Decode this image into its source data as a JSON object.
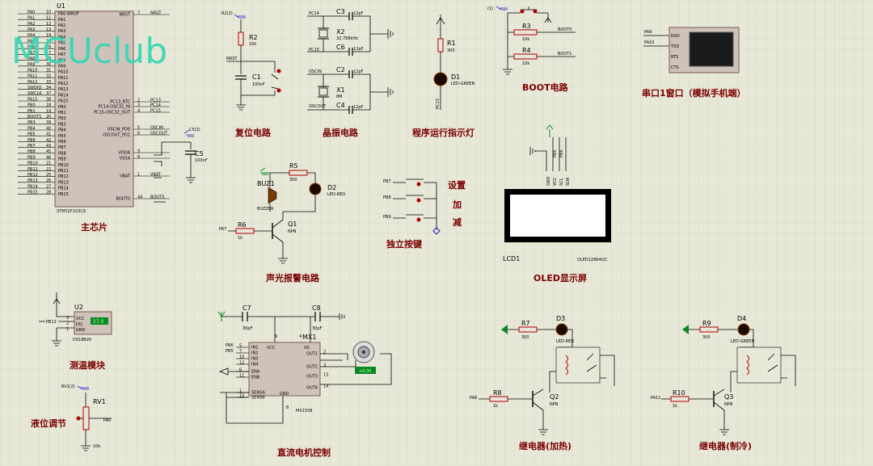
{
  "watermark": "MCUclub",
  "sections": {
    "main_chip": "主芯片",
    "reset": "复位电路",
    "crystal": "晶振电路",
    "indicator": "程序运行指示灯",
    "boot": "BOOT电路",
    "uart": "串口1窗口（模拟手机端）",
    "alarm": "声光报警电路",
    "keys": "独立按键",
    "oled": "OLED显示屏",
    "temp": "测温模块",
    "motor": "直流电机控制",
    "relay_heat": "继电器(加热)",
    "relay_cool": "继电器(制冷)",
    "level": "液位调节"
  },
  "keys_labels": [
    "设置",
    "加",
    "减"
  ],
  "mcu": {
    "ref": "U1",
    "part": "STM32F103C8",
    "left_pins": [
      "PA0",
      "PA1",
      "PA2",
      "PA3",
      "PA4",
      "PA5",
      "PA6",
      "PA7",
      "PA8",
      "PA9",
      "PA10",
      "PA11",
      "PA12",
      "SWDIO",
      "SWCLK",
      "PA15",
      "PB0",
      "PB1",
      "BOOT1",
      "PB3",
      "PB4",
      "PB5",
      "PB6",
      "PB7",
      "PB8",
      "PB9",
      "PB10",
      "PB11",
      "PB12",
      "PB13",
      "PB14",
      "PB15"
    ],
    "left_nums": [
      "10",
      "11",
      "12",
      "13",
      "14",
      "15",
      "16",
      "17",
      "29",
      "30",
      "31",
      "32",
      "33",
      "34",
      "37",
      "38",
      "18",
      "19",
      "20",
      "39",
      "40",
      "41",
      "42",
      "43",
      "45",
      "46",
      "21",
      "22",
      "25",
      "26",
      "27",
      "28"
    ],
    "left_inner": [
      "PA0-WKUP",
      "PA1",
      "PA2",
      "PA3",
      "PA4",
      "PA5",
      "PA6",
      "PA7",
      "PA8",
      "PA9",
      "PA10",
      "PA11",
      "PA12",
      "PA13",
      "PA14",
      "PA15",
      "PB0",
      "PB1",
      "PB2",
      "PB3",
      "PB4",
      "PB5",
      "PB6",
      "PB7",
      "PB8",
      "PB9",
      "PB10",
      "PB11",
      "PB12",
      "PB13",
      "PB14",
      "PB15"
    ],
    "right_pins": [
      "NRST",
      "PC13_RTC",
      "PC14-OSC32_IN",
      "PC15-OSC32_OUT",
      "OSCIN_PD0",
      "OSCOUT_PD1",
      "VDDA",
      "VSSA",
      "VBAT",
      "BOOT0"
    ],
    "right_nums": [
      "7",
      "2",
      "3",
      "4",
      "5",
      "6",
      "9",
      "8",
      "1",
      "44"
    ],
    "right_nets": [
      "NRST",
      "PC13",
      "PC14",
      "PC15",
      "OSCIN",
      "OSCOUT",
      "",
      "",
      "VBAT",
      "BOOT0"
    ]
  },
  "reset_circuit": {
    "r": "R2",
    "r_val": "10k",
    "c": "C1",
    "c_val": "100nF",
    "net": "NRST",
    "probe": "R2(2)"
  },
  "crystal_circuit": {
    "x2": "X2",
    "x2_freq": "32.768kHz",
    "x1": "X1",
    "x1_freq": "8M",
    "c3": "C3",
    "c6": "C6",
    "c2": "C2",
    "c4": "C4",
    "c_val": "12pF",
    "nets": [
      "PC14",
      "PC15",
      "OSCIN",
      "OSCOUT"
    ]
  },
  "indicator_circuit": {
    "r": "R1",
    "r_val": "300",
    "d": "D1",
    "d_type": "LED-GREEN",
    "net": "PC13"
  },
  "boot_circuit": {
    "r3": "R3",
    "r4": "R4",
    "r_val": "10k",
    "nets": [
      "BOOT0",
      "BOOT1"
    ],
    "probe": "(1)"
  },
  "uart_circuit": {
    "nets": [
      "PA9",
      "PA10"
    ],
    "pins": [
      "RXD",
      "TXD",
      "RTS",
      "CTS"
    ]
  },
  "vdda_cap": {
    "c": "C5",
    "c_val": "100nF",
    "probe": "C5(2)"
  },
  "alarm_circuit": {
    "r5": "R5",
    "r5_val": "300",
    "d2": "D2",
    "d2_type": "LED-RED",
    "buz": "BUZ1",
    "buz_type": "BUZZER",
    "r6": "R6",
    "r6_val": "1k",
    "q": "Q1",
    "q_type": "NPN",
    "net": "PA7"
  },
  "keys_circuit": {
    "nets": [
      "PB7",
      "PB8",
      "PB9"
    ]
  },
  "oled_module": {
    "ref": "LCD1",
    "part": "OLED12864I2C",
    "pins": [
      "GND",
      "VCC",
      "SCL",
      "SDA"
    ],
    "nets": [
      "PB5",
      "PB6"
    ]
  },
  "temp_module": {
    "ref": "U2",
    "part": "DS18B20",
    "pins": [
      "VCC",
      "DQ",
      "GND"
    ],
    "nums": [
      "3",
      "2",
      "1"
    ],
    "net": "PB12",
    "reading": "27.0"
  },
  "motor_circuit": {
    "c7": "C7",
    "c8": "C8",
    "c_val": "30pF",
    "mx": "MX1",
    "mx_part": "MX1508",
    "left_pins": [
      "IN1",
      "IN2",
      "IN3",
      "IN4",
      "ENA",
      "ENB",
      "SENSA",
      "SENSB"
    ],
    "left_nums": [
      "5",
      "7",
      "10",
      "12",
      "6",
      "11",
      "1",
      "15"
    ],
    "right_pins": [
      "OUT1",
      "OUT2",
      "OUT3",
      "OUT4"
    ],
    "right_nums": [
      "2",
      "3",
      "13",
      "14"
    ],
    "top_pins": [
      "VCC",
      "VS"
    ],
    "top_nums": [
      "9",
      "4"
    ],
    "gnd_pin": "GND",
    "gnd_num": "8",
    "nets": [
      "PB6",
      "PB5"
    ]
  },
  "relay_heat_circuit": {
    "r7": "R7",
    "r7_val": "300",
    "d3": "D3",
    "d3_type": "LED-RED",
    "r8": "R8",
    "r8_val": "1k",
    "q": "Q2",
    "q_type": "NPN",
    "net": "PA8"
  },
  "relay_cool_circuit": {
    "r9": "R9",
    "r9_val": "300",
    "d4": "D4",
    "d4_type": "LED-GREEN",
    "r10": "R10",
    "r10_val": "1k",
    "q": "Q3",
    "q_type": "NPN",
    "net": "PA11"
  },
  "level_circuit": {
    "rv": "RV1",
    "rv_val": "10k",
    "net": "PA0",
    "probe": "RV1(2)"
  },
  "colors": {
    "background": "#e8e8d8",
    "grid": "#cfcfbe",
    "label": "#7a0000",
    "watermark": "#3ad6b4",
    "chip": "#cfc2ba",
    "wire": "#000000",
    "accent_green": "#0b8a22"
  }
}
